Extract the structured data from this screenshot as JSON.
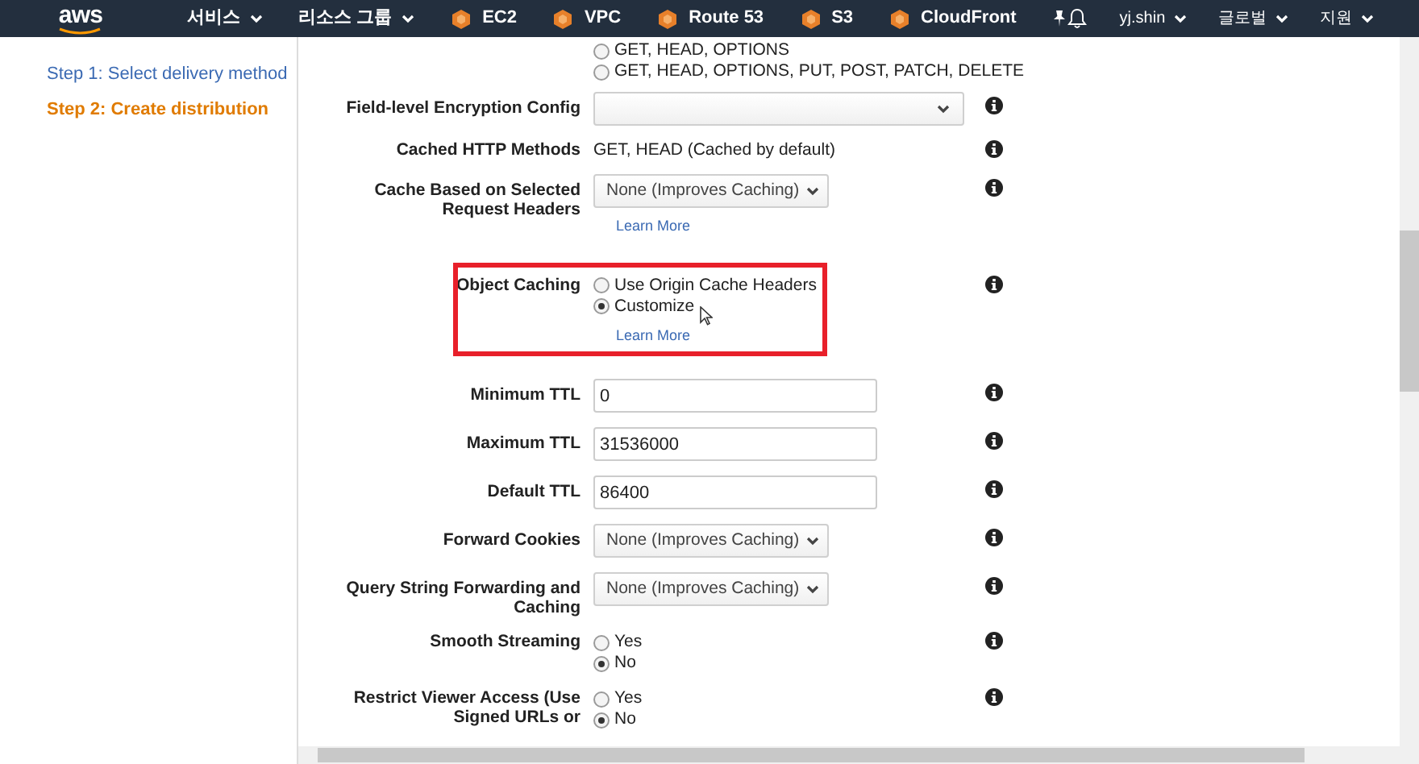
{
  "navbar": {
    "logo": "aws",
    "menus": [
      {
        "label": "서비스",
        "kind": "dropdown"
      },
      {
        "label": "리소스 그룹",
        "kind": "dropdown"
      },
      {
        "label": "EC2",
        "kind": "service"
      },
      {
        "label": "VPC",
        "kind": "service"
      },
      {
        "label": "Route 53",
        "kind": "service"
      },
      {
        "label": "S3",
        "kind": "service"
      },
      {
        "label": "CloudFront",
        "kind": "service"
      }
    ],
    "right": [
      "yj.shin",
      "글로벌",
      "지원"
    ]
  },
  "sidebar": {
    "steps": [
      {
        "label": "Step 1: Select delivery method",
        "selected": false
      },
      {
        "label": "Step 2: Create distribution",
        "selected": true
      }
    ]
  },
  "form": {
    "rows": [
      {
        "kind": "radio",
        "label": "",
        "options": [
          {
            "label": "GET, HEAD, OPTIONS",
            "selected": false
          },
          {
            "label": "GET, HEAD, OPTIONS, PUT, POST, PATCH, DELETE",
            "selected": false
          }
        ],
        "info": false,
        "highlighted": false
      },
      {
        "kind": "select",
        "label": "Field-level Encryption Config",
        "value": "",
        "wide": true,
        "info": true,
        "highlighted": false
      },
      {
        "kind": "static",
        "label": "Cached HTTP Methods",
        "value": "GET, HEAD (Cached by default)",
        "info": true,
        "highlighted": false
      },
      {
        "kind": "select",
        "label": "Cache Based on Selected Request Headers",
        "value": "None (Improves Caching)",
        "wide": false,
        "link": "Learn More",
        "info": true,
        "highlighted": false
      },
      {
        "kind": "radio",
        "label": "Object Caching",
        "options": [
          {
            "label": "Use Origin Cache Headers",
            "selected": false
          },
          {
            "label": "Customize",
            "selected": true
          }
        ],
        "link": "Learn More",
        "info": true,
        "highlighted": true
      },
      {
        "kind": "input",
        "label": "Minimum TTL",
        "value": "0",
        "info": true,
        "highlighted": false
      },
      {
        "kind": "input",
        "label": "Maximum TTL",
        "value": "31536000",
        "info": true,
        "highlighted": false
      },
      {
        "kind": "input",
        "label": "Default TTL",
        "value": "86400",
        "info": true,
        "highlighted": false
      },
      {
        "kind": "select",
        "label": "Forward Cookies",
        "value": "None (Improves Caching)",
        "wide": false,
        "info": true,
        "highlighted": false
      },
      {
        "kind": "select",
        "label": "Query String Forwarding and Caching",
        "value": "None (Improves Caching)",
        "wide": false,
        "info": true,
        "highlighted": false
      },
      {
        "kind": "radio",
        "label": "Smooth Streaming",
        "options": [
          {
            "label": "Yes",
            "selected": false
          },
          {
            "label": "No",
            "selected": true
          }
        ],
        "info": true,
        "highlighted": false
      },
      {
        "kind": "radio",
        "label": "Restrict Viewer Access (Use Signed URLs or",
        "options": [
          {
            "label": "Yes",
            "selected": false
          },
          {
            "label": "No",
            "selected": true
          }
        ],
        "info": true,
        "highlighted": false
      }
    ]
  }
}
